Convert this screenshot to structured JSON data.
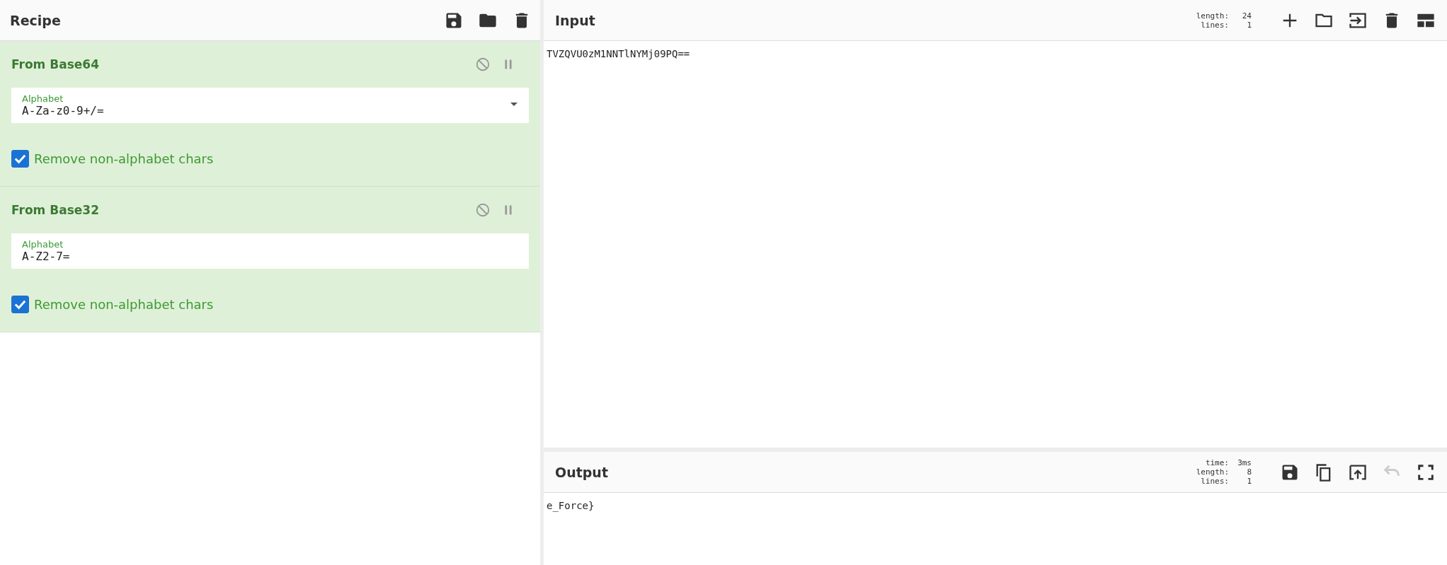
{
  "recipe": {
    "title": "Recipe",
    "operations": [
      {
        "name": "From Base64",
        "disabled": false,
        "paused": false,
        "field": {
          "kind": "select",
          "label": "Alphabet",
          "value": "A-Za-z0-9+/="
        },
        "checkbox": {
          "label": "Remove non-alphabet chars",
          "checked": true
        }
      },
      {
        "name": "From Base32",
        "disabled": false,
        "paused": false,
        "field": {
          "kind": "text",
          "label": "Alphabet",
          "value": "A-Z2-7="
        },
        "checkbox": {
          "label": "Remove non-alphabet chars",
          "checked": true
        }
      }
    ]
  },
  "input": {
    "title": "Input",
    "stats": [
      {
        "label": "length:",
        "value": "24"
      },
      {
        "label": "lines:",
        "value": "1"
      }
    ],
    "text": "TVZQVU0zM1NNTlNYMj09PQ=="
  },
  "output": {
    "title": "Output",
    "stats": [
      {
        "label": "time:",
        "value": "3ms"
      },
      {
        "label": "length:",
        "value": "8"
      },
      {
        "label": "lines:",
        "value": "1"
      }
    ],
    "undo_disabled": true,
    "text": "e_Force}"
  }
}
